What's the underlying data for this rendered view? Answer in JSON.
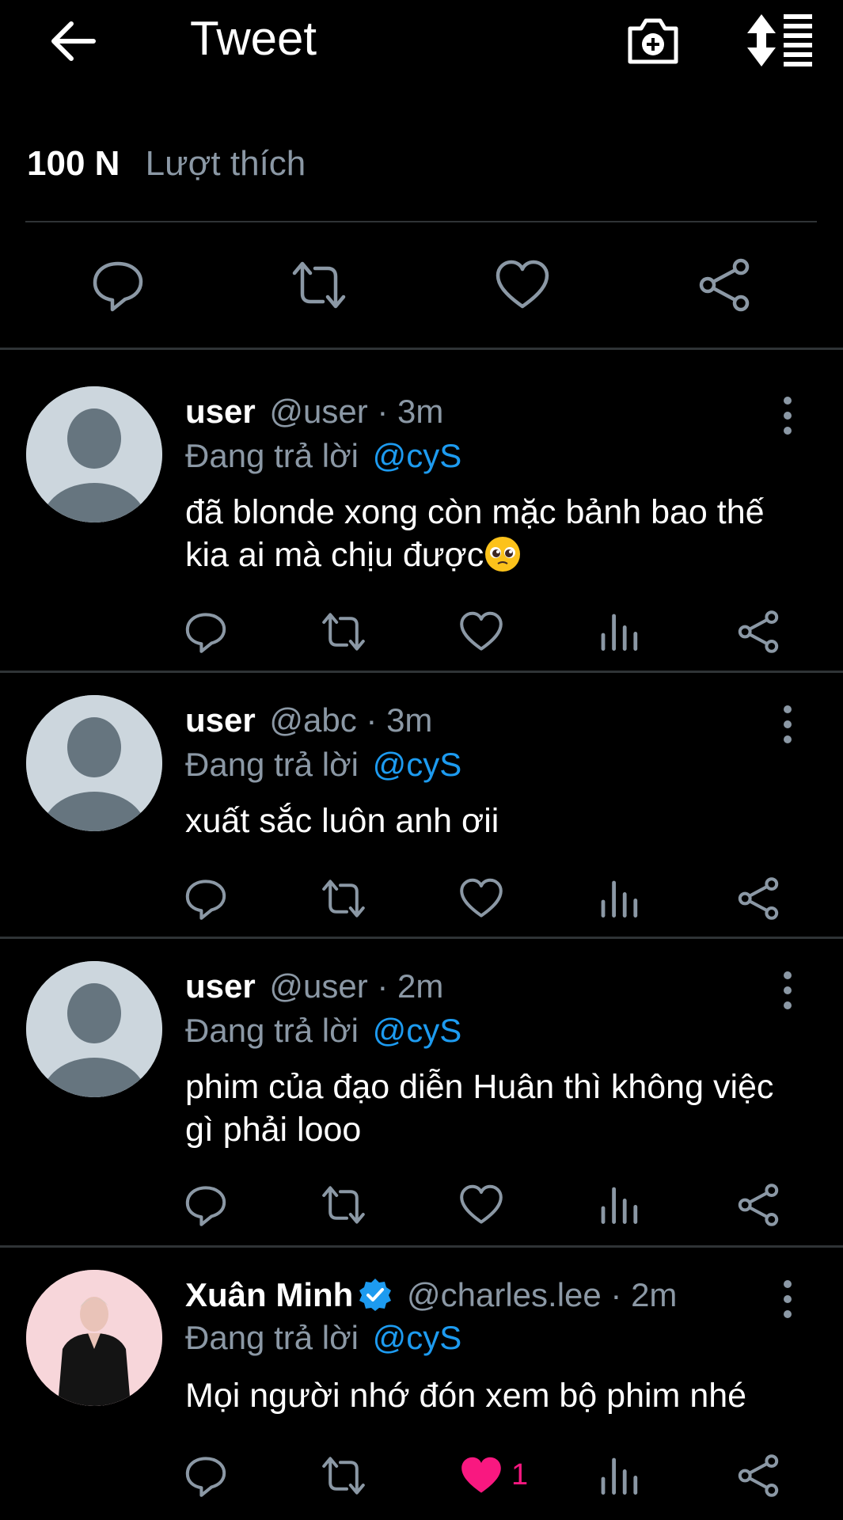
{
  "header": {
    "back_icon": "arrow-left-icon",
    "title": "Tweet",
    "camera_icon": "camera-plus-icon",
    "sort_icon": "sort-list-icon"
  },
  "likes": {
    "count": "100 N",
    "label": "Lượt thích"
  },
  "replies": [
    {
      "name": "user",
      "handle": "@user · 3m",
      "replying_label": "Đang trả lời",
      "mention": "@cyS",
      "text": "đã blonde xong còn mặc bảnh bao thế kia ai mà chịu được",
      "emoji": "pleading-face-emoji",
      "like_count": ""
    },
    {
      "name": "user",
      "handle": "@abc · 3m",
      "replying_label": "Đang trả lời",
      "mention": "@cyS",
      "text": "xuất sắc luôn anh ơii",
      "like_count": ""
    },
    {
      "name": "user",
      "handle": "@user · 2m",
      "replying_label": "Đang trả lời",
      "mention": "@cyS",
      "text": "phim của đạo diễn Huân thì không việc gì phải looo",
      "like_count": ""
    },
    {
      "name": "Xuân Minh",
      "verified": true,
      "handle": "@charles.lee · 2m",
      "replying_label": "Đang trả lời",
      "mention": "@cyS",
      "text": "Mọi người nhớ đón xem bộ phim nhé",
      "like_count": "1",
      "liked": true
    }
  ],
  "colors": {
    "background": "#000000",
    "muted": "#8b98a5",
    "accent": "#1d9bf0",
    "like": "#f91880",
    "divider": "#2f3336"
  }
}
